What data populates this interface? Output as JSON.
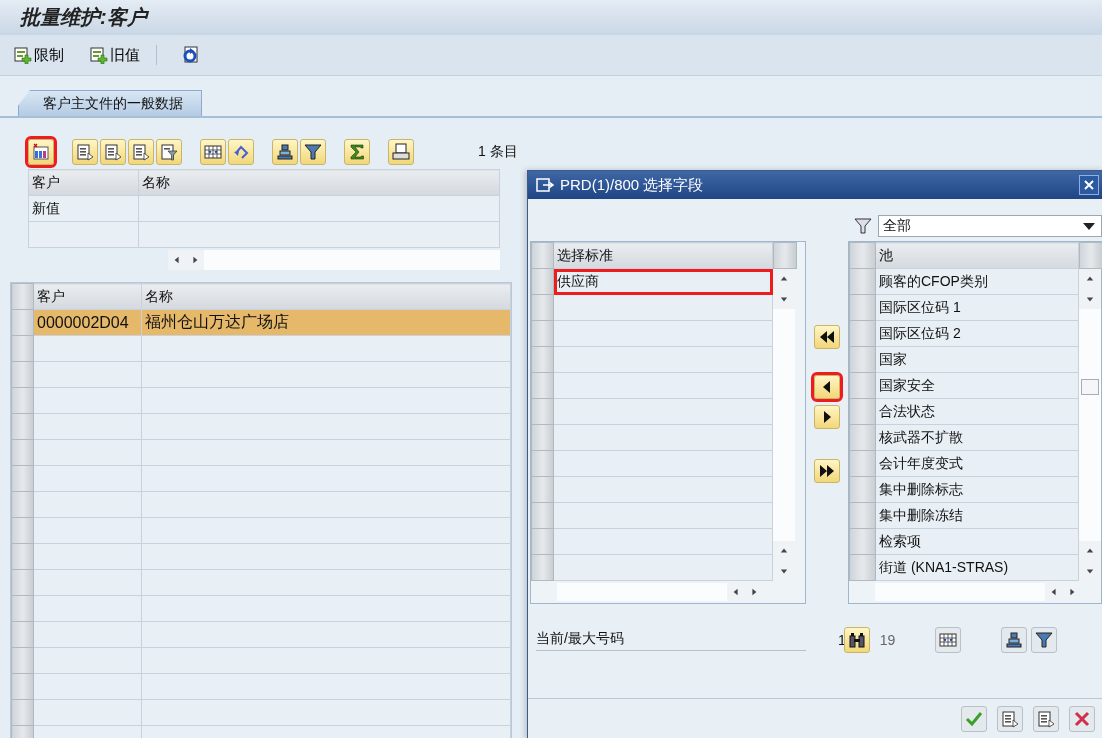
{
  "window": {
    "title": "批量维护:客户"
  },
  "toolbar": [
    {
      "kind": "add",
      "label": "限制"
    },
    {
      "kind": "add",
      "label": "旧值"
    },
    {
      "kind": "refresh"
    }
  ],
  "tabs": [
    {
      "label": "客户主文件的一般数据",
      "selected": true
    }
  ],
  "alv_toolbar": {
    "buttons": [
      {
        "kind": "columns",
        "highlighted": true
      },
      {
        "kind": "detail",
        "highlighted": false
      },
      {
        "kind": "detail",
        "highlighted": false
      },
      {
        "kind": "detail",
        "highlighted": false
      },
      {
        "kind": "detail-filter",
        "highlighted": false
      },
      {
        "kind": "grid",
        "highlighted": false
      },
      {
        "kind": "undo",
        "highlighted": false
      },
      {
        "kind": "sort",
        "highlighted": false
      },
      {
        "kind": "filter",
        "highlighted": false
      },
      {
        "kind": "sum",
        "highlighted": false
      },
      {
        "kind": "print",
        "highlighted": false
      }
    ],
    "entries": "1 条目"
  },
  "upper_table": {
    "columns": [
      "客户",
      "名称"
    ],
    "rows": [
      {
        "customer": "新值"
      }
    ]
  },
  "lower_table": {
    "columns": [
      "客户",
      "名称"
    ],
    "rows": [
      {
        "customer": "0000002D04",
        "name": "福州仓山万达广场店",
        "selected": true
      }
    ]
  },
  "dialog": {
    "title": "PRD(1)/800 选择字段",
    "filter": {
      "value": "全部"
    },
    "selected_fields": {
      "column": "选择标准",
      "rows": [
        {
          "label": "供应商",
          "highlighted": true
        }
      ]
    },
    "move_buttons": [
      {
        "kind": "all-left",
        "highlighted": false
      },
      {
        "kind": "left",
        "highlighted": true
      },
      {
        "kind": "right",
        "highlighted": false
      },
      {
        "kind": "all-right",
        "highlighted": false
      }
    ],
    "pool": {
      "column": "池",
      "rows": [
        "顾客的CFOP类别",
        "国际区位码 1",
        "国际区位码 2",
        "国家",
        "国家安全",
        "合法状态",
        "核武器不扩散",
        "会计年度变式",
        "集中删除标志",
        "集中删除冻结",
        "检索项",
        "街道 (KNA1-STRAS)"
      ]
    },
    "counter": {
      "label": "当前/最大号码",
      "current": "1",
      "max": "19"
    },
    "footer_buttons": [
      {
        "kind": "confirm"
      },
      {
        "kind": "detail"
      },
      {
        "kind": "detail"
      },
      {
        "kind": "cancel"
      }
    ]
  }
}
